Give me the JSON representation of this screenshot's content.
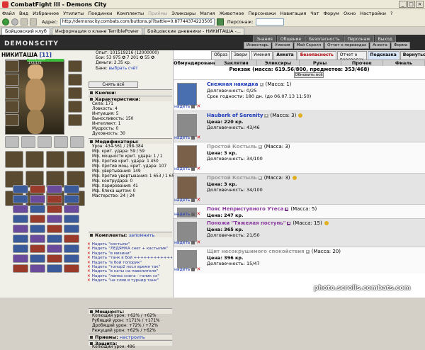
{
  "window": {
    "title": "CombatFight III - Demons City"
  },
  "menu": [
    "Файл",
    "Вид",
    "Избранное",
    "Утилиты",
    "Поединки",
    "Комплекты",
    "Приёмы",
    "Эликсиры",
    "Магия",
    "Животное",
    "Персонажи",
    "Навигация",
    "Чат",
    "Форум",
    "Окно",
    "Настройки",
    "?"
  ],
  "address": {
    "label": "Адрес:",
    "url": "http://demonscity.combats.com/buttons.pl?battle=0.87744374223505",
    "right_label": "Персонаж:"
  },
  "tabs": [
    "Бойцовский клуб",
    "Информация о клане TerriblePower",
    "Бойцовские дневники - НИКИТАША -..."
  ],
  "game": {
    "logo": "DEMONSCITY",
    "topnav": [
      "Знания",
      "Общение",
      "Безопасность",
      "Персонаж",
      "Выход"
    ],
    "subnav": [
      "Инвентарь",
      "Умения",
      "Мой Скролл",
      "Отчет о переводах",
      "Анкета",
      "Форма"
    ]
  },
  "character": {
    "name": "НИКИТАША",
    "level": "[11]",
    "hp": "3064/3064",
    "mp": "172/172",
    "stats": [
      {
        "k": "Опыт:",
        "v": "101519216 (12000000)"
      },
      {
        "k": "Бои:",
        "v": "53 975 ✪ 7 201 ✪ 55 ✪"
      },
      {
        "k": "Деньги:",
        "v": "2.35 кр."
      },
      {
        "k": "Банк:",
        "v": "выбрать счёт"
      }
    ],
    "take_all": "Снять всё",
    "sections": {
      "buttons": "Кнопки:",
      "features": "Характеристики:",
      "modifiers": "Модификаторы:",
      "kits": "Комплекты:",
      "kits_link": "запомнить",
      "power": "Мощность:",
      "spells": "Приемы:",
      "spells_link": "настроить",
      "protect": "Защита:"
    },
    "features": [
      "Сила: 171",
      "Ловкость: 4",
      "Интуиция: 5",
      "Выносливость: 150",
      "Интеллект: 1",
      "Мудрость: 0",
      "Духовность: 30"
    ],
    "modifiers": [
      "Урон: 434-561 / 298-384",
      "Мф. крит. удара: 59 / 59",
      "Мф. мощности крит. удара: 1 / 1",
      "Мф. против крит. удара: 1 450",
      "Мф. против мощ. крит. удара: 107",
      "Мф. увертывания: 149",
      "Мф. против увертывания: 1 653 / 1 653",
      "Мф. контрудара: 0",
      "Мф. парирования: 41",
      "Мф. блока щитом: 0",
      "Мастерство: 24 / 24"
    ],
    "kits": [
      {
        "label": "Надеть",
        "name": "\"костыли\""
      },
      {
        "label": "Надеть",
        "name": "\"ЛЕДЯНКА снег + кастылик\""
      },
      {
        "label": "Надеть",
        "name": "\"в мизини\""
      },
      {
        "label": "Надеть",
        "name": "\"танк в бой +++++++++++++++\""
      },
      {
        "label": "Надеть",
        "name": "\"в бой топорик\""
      },
      {
        "label": "Надеть",
        "name": "\"топор2 посл время так\""
      },
      {
        "label": "Надеть",
        "name": "\"в каты на павелителя\""
      },
      {
        "label": "Надеть",
        "name": "\"лапка снега - голик сх\""
      },
      {
        "label": "Надеть",
        "name": "\"на слив в турнир танк\""
      }
    ],
    "power": [
      "Колющий урон: +62% / +62%",
      "Рубящий урон: +171% / +171%",
      "Дробящий урон: +72% / +72%",
      "Режущий урон: +62% / +62%"
    ],
    "protect": [
      "Колющий урон: 496"
    ]
  },
  "right": {
    "tabs1": [
      "Образ",
      "Звери",
      "Умения",
      "Анкета",
      "Безопасность",
      "Отчет о переводах",
      "Подсказка",
      "Вернуться"
    ],
    "tabs2": [
      "Обмундирование",
      "Заклятия",
      "Эликсиры",
      "Руны",
      "Прочее",
      "Фиаль"
    ],
    "rucksack": "Рюкзак (масса: 619.56/800, предметов: 353/468)",
    "refresh": "Обновить всё",
    "wear_label": "надеть",
    "items": [
      {
        "name": "Снежная накидка",
        "mass": "(Масса: 1)",
        "lines": [
          "Долговечность: 0/25",
          "Срок годности: 180 дн. (до 06.07.13 11:50)"
        ],
        "color": "blue",
        "pic": "blue"
      },
      {
        "name": "Hauberk of Serenity",
        "mass": "(Масса: 3)",
        "lines": [
          "Цена: 220 кр.",
          "Долговечность: 43/46"
        ],
        "color": "blue",
        "pic": "gray",
        "coin": true
      },
      {
        "name": "Простой Костыль",
        "mass": "(Масса: 3)",
        "lines": [
          "Цена: 3 кр.",
          "Долговечность: 34/100"
        ],
        "color": "gray",
        "pic": "brown"
      },
      {
        "name": "Простой Костыль",
        "mass": "(Масса: 3)",
        "lines": [
          "Цена: 3 кр.",
          "Долговечность: 34/100"
        ],
        "color": "gray",
        "pic": "brown",
        "coin": true
      },
      {
        "name": "Пояс Неприступного Утеса",
        "mass": "(Масса: 5)",
        "lines": [
          "Цена: 247 кр.",
          "Долговечность: 38/45"
        ],
        "color": "purple",
        "pic": "gray"
      },
      {
        "name": "Поножи \"Тяжелая поступь\"",
        "mass": "(Масса: 15)",
        "lines": [
          "Цена: 365 кр.",
          "Долговечность: 21/50"
        ],
        "color": "purple",
        "pic": "gray",
        "coin": true
      },
      {
        "name": "Щит несокрушимого спокойствия",
        "mass": "(Масса: 20)",
        "lines": [
          "Цена: 396 кр.",
          "Долговечность: 15/47"
        ],
        "color": "gray",
        "pic": "gray"
      }
    ]
  },
  "watermark": "photo.scrolls.combats.com"
}
